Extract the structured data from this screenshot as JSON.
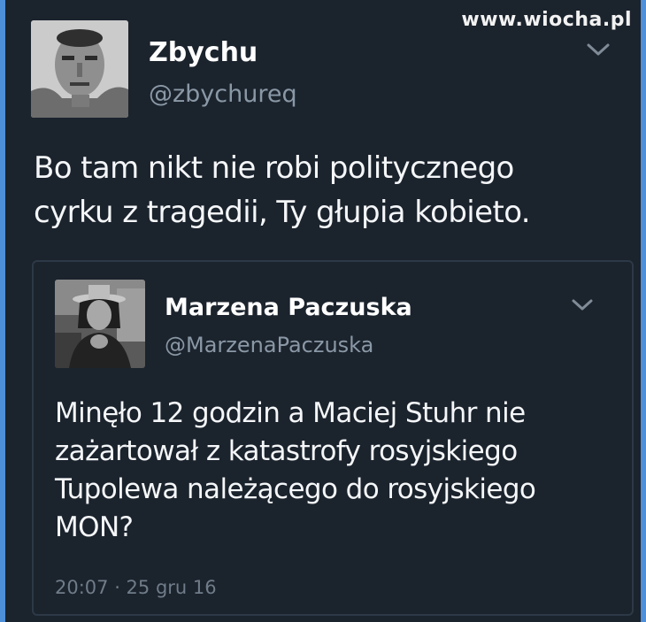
{
  "watermark": "www.wiocha.pl",
  "tweet": {
    "author_name": "Zbychu",
    "author_handle": "@zbychureq",
    "text": "Bo tam nikt nie robi politycznego cyrku z tragedii, Ty głupia kobieto.",
    "menu_icon": "chevron-down-icon"
  },
  "quoted_tweet": {
    "author_name": "Marzena Paczuska",
    "author_handle": "@MarzenaPaczuska",
    "text": "Minęło 12 godzin a Maciej Stuhr nie zażartował z katastrofy rosyjskiego Tupolewa należącego do rosyjskiego MON?",
    "timestamp": "20:07 · 25 gru 16",
    "menu_icon": "chevron-down-icon"
  },
  "colors": {
    "background": "#1b232d",
    "outer_border": "#4d8fd9",
    "text_primary": "#f4f6f8",
    "text_secondary": "#8a98a6",
    "quote_border": "#2d3947"
  }
}
